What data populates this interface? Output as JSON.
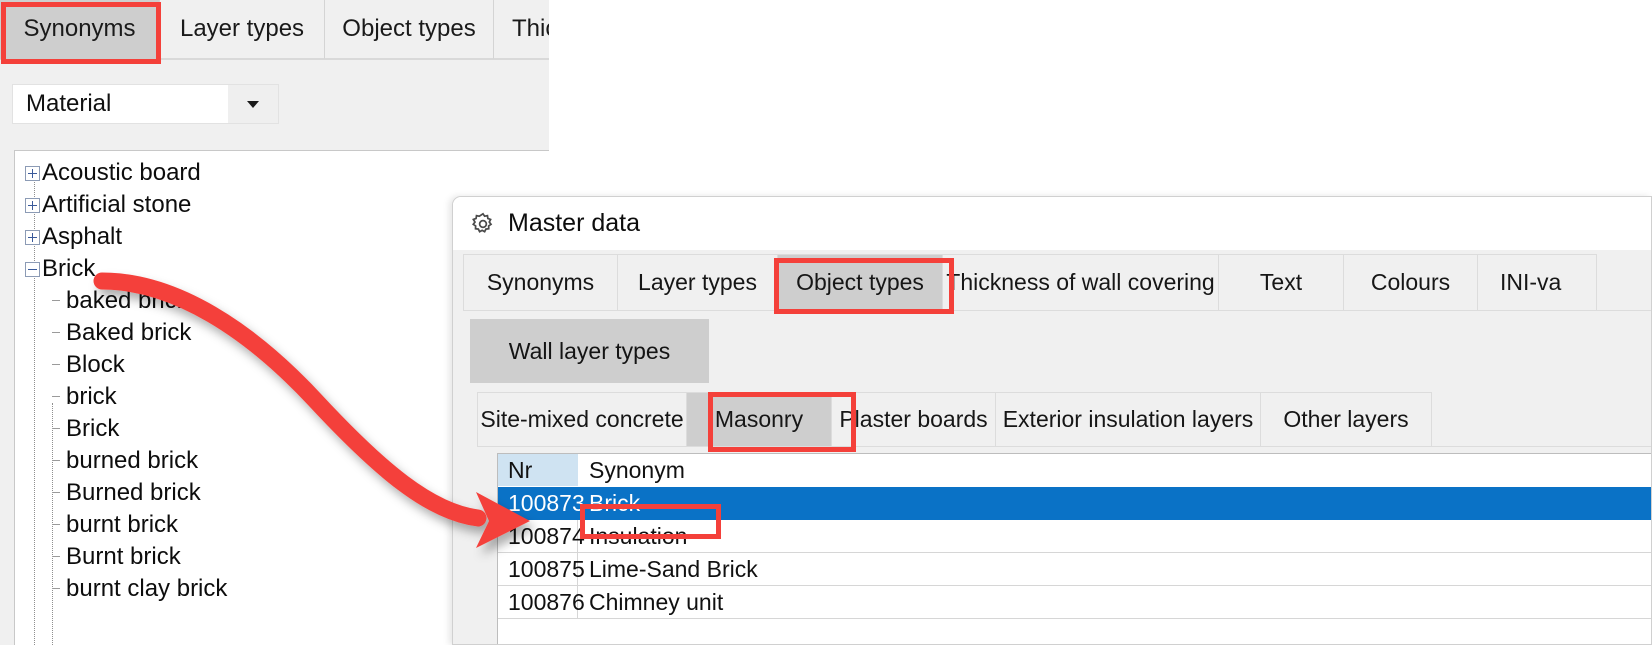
{
  "back_window": {
    "tabs": [
      {
        "label": "Synonyms",
        "active": true,
        "highlighted": true
      },
      {
        "label": "Layer types",
        "active": false,
        "highlighted": false
      },
      {
        "label": "Object types",
        "active": false,
        "highlighted": false
      },
      {
        "label": "Thickness of wall covering",
        "active": false,
        "highlighted": false
      }
    ],
    "combo": {
      "value": "Material",
      "placeholder": "Material"
    },
    "tree": [
      {
        "label": "Acoustic board",
        "level": 0,
        "expanded": false
      },
      {
        "label": "Artificial stone",
        "level": 0,
        "expanded": false
      },
      {
        "label": "Asphalt",
        "level": 0,
        "expanded": false
      },
      {
        "label": "Brick",
        "level": 0,
        "expanded": true
      },
      {
        "label": "baked brick",
        "level": 1
      },
      {
        "label": "Baked brick",
        "level": 1
      },
      {
        "label": "Block",
        "level": 1
      },
      {
        "label": "brick",
        "level": 1
      },
      {
        "label": "Brick",
        "level": 1
      },
      {
        "label": "burned brick",
        "level": 1
      },
      {
        "label": "Burned brick",
        "level": 1
      },
      {
        "label": "burnt brick",
        "level": 1
      },
      {
        "label": "Burnt brick",
        "level": 1
      },
      {
        "label": "burnt clay brick",
        "level": 1
      }
    ]
  },
  "dialog": {
    "title": "Master data",
    "gear_icon": "gear-icon",
    "tabs_level1": [
      {
        "label": "Synonyms",
        "active": false,
        "highlighted": false
      },
      {
        "label": "Layer types",
        "active": false,
        "highlighted": false
      },
      {
        "label": "Object types",
        "active": true,
        "highlighted": true
      },
      {
        "label": "Thickness of wall covering",
        "active": false,
        "highlighted": false
      },
      {
        "label": "Text",
        "active": false,
        "highlighted": false
      },
      {
        "label": "Colours",
        "active": false,
        "highlighted": false
      },
      {
        "label": "INI-va",
        "active": false,
        "highlighted": false
      }
    ],
    "tabs_group": [
      {
        "label": "Wall layer types",
        "active": true
      }
    ],
    "tabs_level2": [
      {
        "label": "Site-mixed concrete",
        "active": false,
        "highlighted": false
      },
      {
        "label": "Masonry",
        "active": true,
        "highlighted": true
      },
      {
        "label": "Plaster boards",
        "active": false,
        "highlighted": false
      },
      {
        "label": "Exterior insulation layers",
        "active": false,
        "highlighted": false
      },
      {
        "label": "Other layers",
        "active": false,
        "highlighted": false
      }
    ],
    "grid": {
      "columns": [
        "Nr",
        "Synonym"
      ],
      "rows": [
        {
          "nr": "100873",
          "synonym": "Brick",
          "selected": true
        },
        {
          "nr": "100874",
          "synonym": "Insulation",
          "selected": false
        },
        {
          "nr": "100875",
          "synonym": "Lime-Sand Brick",
          "selected": false
        },
        {
          "nr": "100876",
          "synonym": "Chimney unit",
          "selected": false
        }
      ]
    }
  },
  "annotations": {
    "accent_red": "#f4403a",
    "selection_blue": "#0a72c6",
    "header_blue": "#cfe3f2",
    "active_tab_grey": "#cecece",
    "arrow_from": "Brick (tree node)",
    "arrow_to": "Brick (grid row 100873)"
  }
}
